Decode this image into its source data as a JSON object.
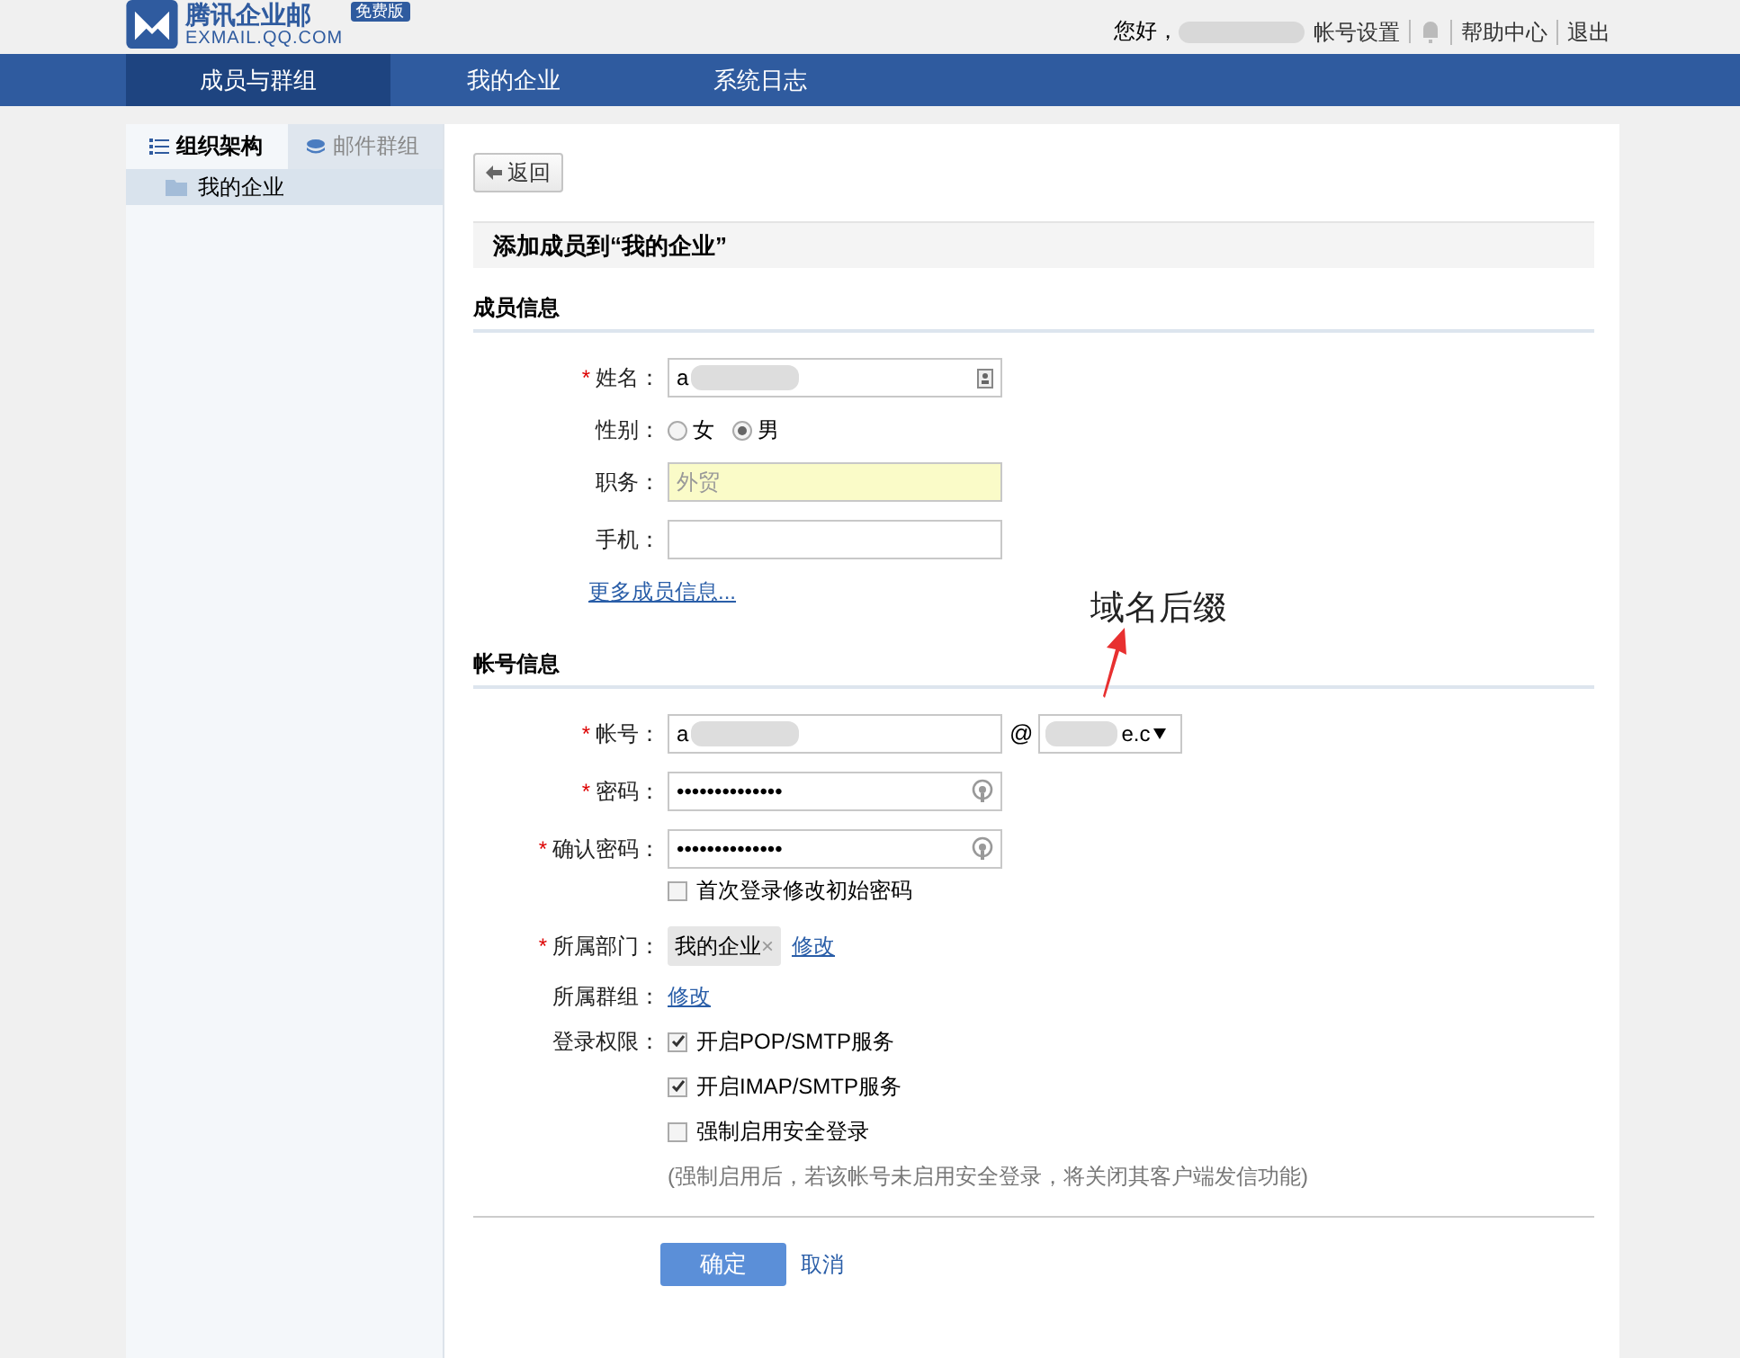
{
  "header": {
    "logo_title": "腾讯企业邮",
    "logo_subtitle": "EXMAIL.QQ.COM",
    "edition_badge": "免费版",
    "greeting": "您好，",
    "account_link": "帐号设置",
    "links": [
      "帮助中心",
      "退出"
    ]
  },
  "nav": [
    {
      "label": "成员与群组",
      "selected": true
    },
    {
      "label": "我的企业",
      "selected": false
    },
    {
      "label": "系统日志",
      "selected": false
    }
  ],
  "sidebar": {
    "tabs": [
      {
        "label": "组织架构",
        "selected": true,
        "kind": "list"
      },
      {
        "label": "邮件群组",
        "selected": false,
        "kind": "stack"
      }
    ],
    "tree": [
      {
        "label": "我的企业",
        "selected": true
      }
    ]
  },
  "back_button": "返回",
  "form_title": "添加成员到“我的企业”",
  "member_section": {
    "title": "成员信息",
    "name": {
      "label": "姓名：",
      "required_mark": "*",
      "value": "a"
    },
    "gender": {
      "label": "性别：",
      "options": [
        {
          "label": "女",
          "selected": false
        },
        {
          "label": "男",
          "selected": true
        }
      ]
    },
    "position": {
      "label": "职务：",
      "placeholder": "外贸",
      "autofilled": true
    },
    "mobile": {
      "label": "手机："
    },
    "more_link": "更多成员信息..."
  },
  "account_section": {
    "title": "帐号信息",
    "account": {
      "label": "帐号：",
      "required_mark": "*",
      "value": "a",
      "at": "@",
      "domain": "e.c"
    },
    "password": {
      "label": "密码：",
      "required_mark": "*",
      "value": "••••••••••••••"
    },
    "confirm_password": {
      "label": "确认密码：",
      "required_mark": "*",
      "value": "••••••••••••••"
    },
    "change_on_first_login": {
      "label": "首次登录修改初始密码",
      "checked": false
    },
    "department": {
      "label": "所属部门：",
      "required_mark": "*",
      "tag": "我的企业",
      "remove": "×",
      "edit_link": "修改"
    },
    "group": {
      "label": "所属群组：",
      "edit_link": "修改"
    },
    "permissions": {
      "label": "登录权限：",
      "options": [
        {
          "label": "开启POP/SMTP服务",
          "checked": true
        },
        {
          "label": "开启IMAP/SMTP服务",
          "checked": true
        },
        {
          "label": "强制启用安全登录",
          "checked": false
        }
      ],
      "note": "(强制启用后，若该帐号未启用安全登录，将关闭其客户端发信功能)"
    }
  },
  "buttons": {
    "confirm": "确定",
    "cancel": "取消"
  },
  "annotation": {
    "text": "域名后缀"
  }
}
